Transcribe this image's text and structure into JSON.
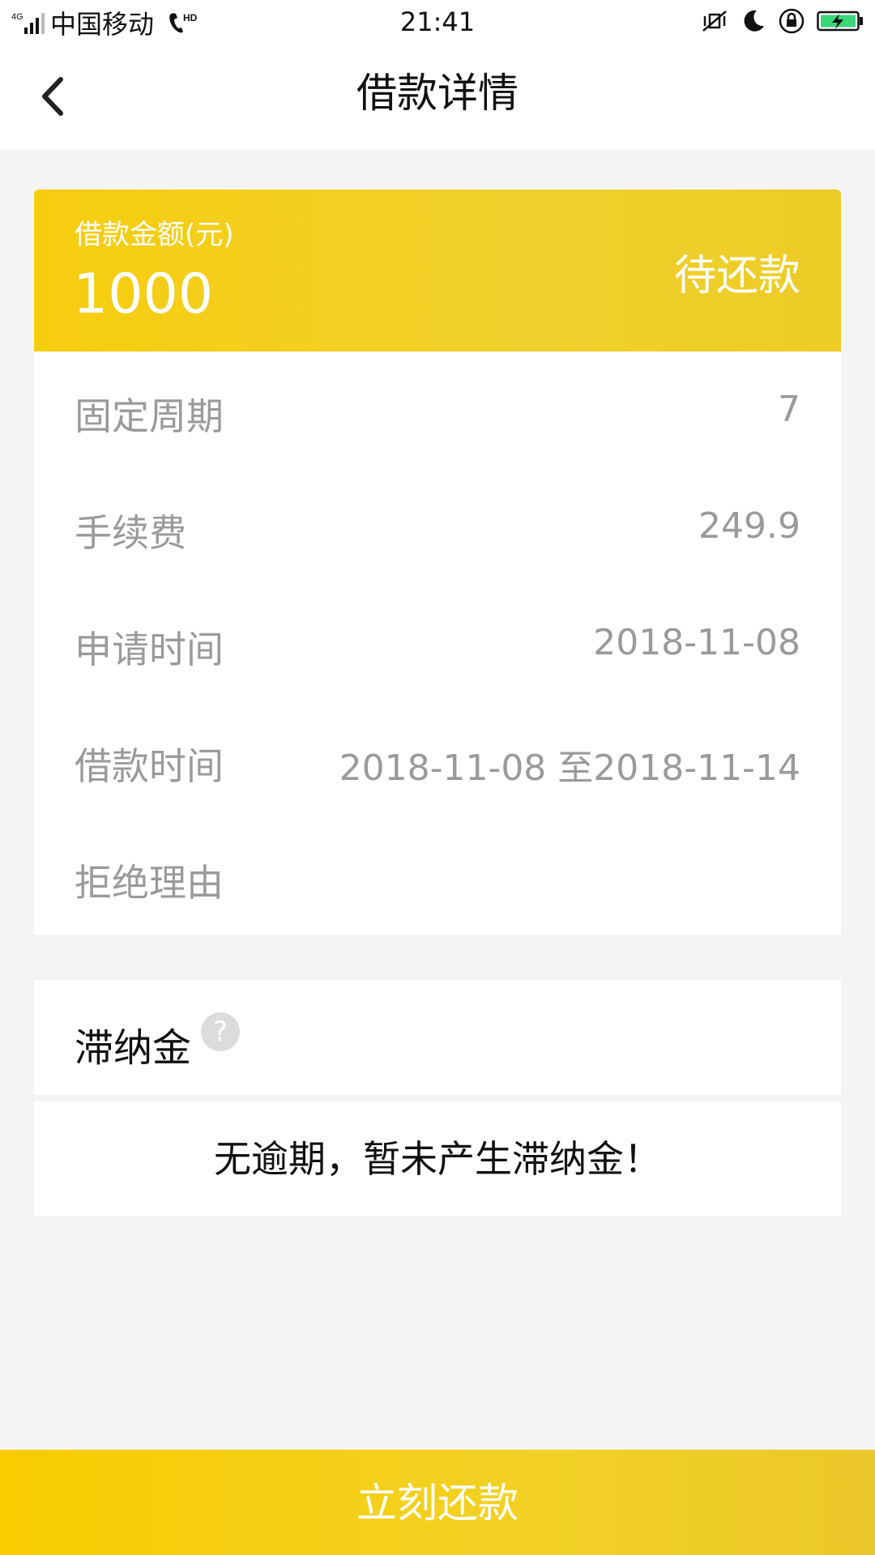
{
  "status_bar": {
    "network": "4G",
    "carrier": "中国移动",
    "hd": "HD",
    "time": "21:41"
  },
  "header": {
    "title": "借款详情",
    "back_icon": "chevron-left-icon"
  },
  "loan": {
    "amount_label": "借款金额(元)",
    "amount": "1000",
    "status": "待还款",
    "colors": {
      "banner": "#f4cf1a",
      "text_muted": "#9a9a9a"
    },
    "details": [
      {
        "label": "固定周期",
        "value": "7"
      },
      {
        "label": "手续费",
        "value": "249.9"
      },
      {
        "label": "申请时间",
        "value": "2018-11-08"
      },
      {
        "label": "借款时间",
        "value": "2018-11-08 至2018-11-14"
      },
      {
        "label": "拒绝理由",
        "value": ""
      }
    ]
  },
  "late_fee": {
    "title": "滞纳金",
    "help_icon": "question-circle-icon",
    "help_glyph": "?",
    "note": "无逾期，暂未产生滞纳金！"
  },
  "footer": {
    "repay_label": "立刻还款"
  }
}
